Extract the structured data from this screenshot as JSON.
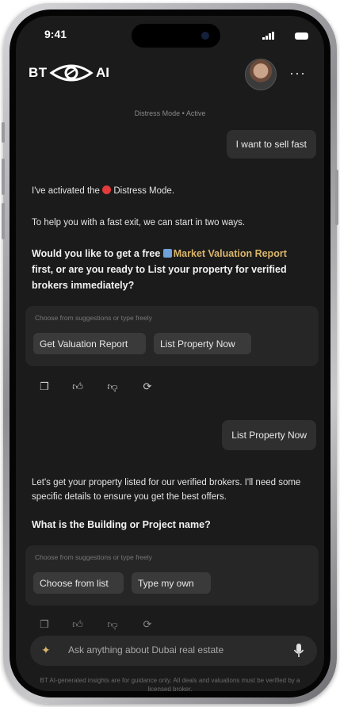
{
  "status_bar": {
    "time": "9:41"
  },
  "header": {
    "brand_left": "BT",
    "brand_right": "AI",
    "more_label": "···"
  },
  "mode_banner": "Distress Mode • Active",
  "messages": {
    "user1": "I want to sell fast",
    "ai1_line1_pre": "I've activated the ",
    "ai1_line1_post": " Distress Mode.",
    "ai1_line2": "To help you with a fast exit, we can start in two ways.",
    "ai1_q_pre": "Would you like to get a free ",
    "ai1_q_link": "Market Valuation Report",
    "ai1_q_post": " first, or are you ready to List your property for verified brokers immediately?",
    "user2": "List Property Now",
    "ai2_text": "Let's get your property listed for our verified brokers. I'll need some specific details to ensure you get the best offers.",
    "ai2_question": "What is the Building or Project name?"
  },
  "suggestions1": {
    "hint": "Choose from suggestions or type freely",
    "chips": [
      "Get Valuation Report",
      "List Property Now"
    ]
  },
  "suggestions2": {
    "hint": "Choose from suggestions or type freely",
    "chips": [
      "Choose from list",
      "Type my own"
    ]
  },
  "input": {
    "placeholder": "Ask anything about Dubai real estate"
  },
  "disclaimer": "BT AI-generated insights are for guidance only. All deals and valuations must be verified by a licensed broker.",
  "colors": {
    "background": "#1b1b1b",
    "accent": "#d9b46a",
    "distress_dot": "#e23b3b"
  },
  "icons": [
    "copy-icon",
    "thumbs-up-icon",
    "thumbs-down-icon",
    "regenerate-icon",
    "sparkle-icon",
    "microphone-icon",
    "brand-eye-icon"
  ]
}
